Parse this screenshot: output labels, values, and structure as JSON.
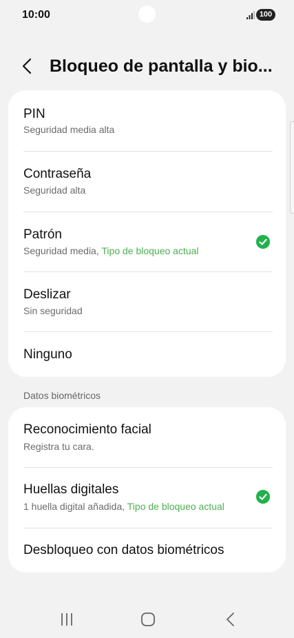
{
  "status_bar": {
    "time": "10:00",
    "battery": "100",
    "icons": [
      "camera-hole",
      "signal-icon",
      "battery-icon"
    ]
  },
  "header": {
    "back_icon": "back-chevron-icon",
    "title": "Bloqueo de pantalla y bio..."
  },
  "lock_types": [
    {
      "title": "PIN",
      "subtitle": "Seguridad media alta"
    },
    {
      "title": "Contraseña",
      "subtitle": "Seguridad alta"
    },
    {
      "title": "Patrón",
      "subtitle": "Seguridad media",
      "separator": ", ",
      "current_label": "Tipo de bloqueo actual"
    },
    {
      "title": "Deslizar",
      "subtitle": "Sin seguridad"
    },
    {
      "title": "Ninguno"
    }
  ],
  "biometrics": {
    "section_label": "Datos biométricos",
    "items": [
      {
        "title": "Reconocimiento facial",
        "subtitle": "Registra tu cara."
      },
      {
        "title": "Huellas digitales",
        "subtitle": "1 huella digital añadida",
        "separator": ", ",
        "current_label": "Tipo de bloqueo actual"
      },
      {
        "title": "Desbloqueo con datos biométricos"
      }
    ]
  },
  "nav_bar": {
    "icons": [
      "recent-apps-icon",
      "home-icon",
      "back-nav-icon"
    ]
  },
  "colors": {
    "accent_green": "#4caf50",
    "check_green": "#23b14d",
    "background": "#f2f2f2",
    "card": "#ffffff"
  }
}
